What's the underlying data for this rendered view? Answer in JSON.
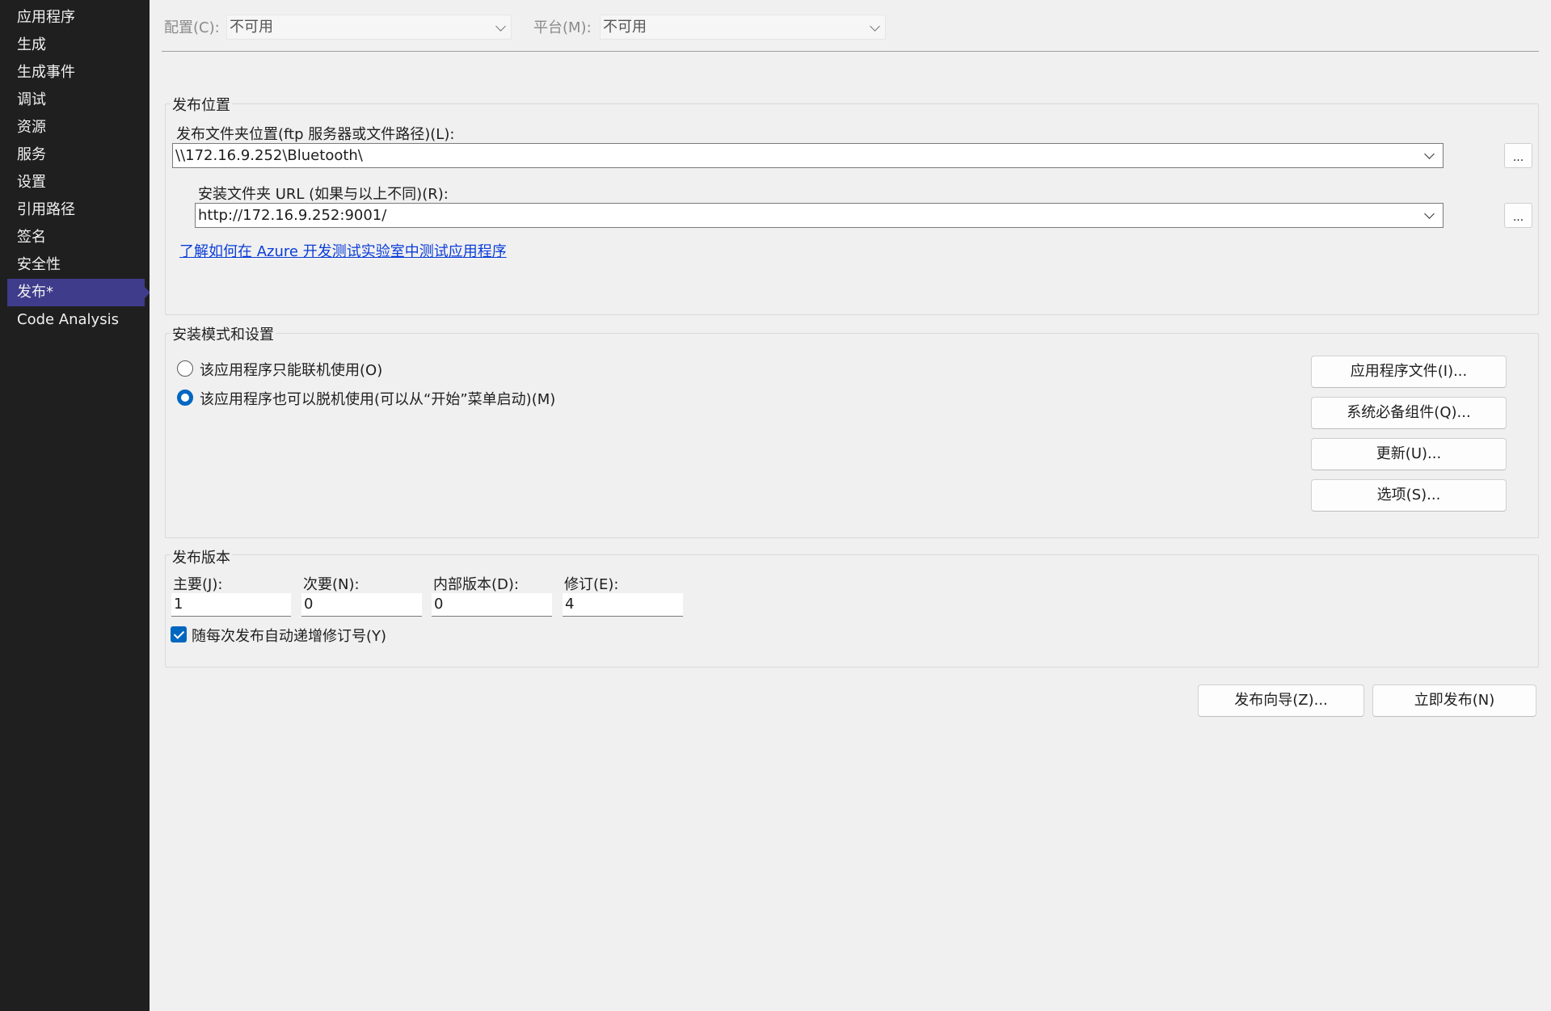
{
  "sidebar": {
    "items": [
      {
        "label": "应用程序"
      },
      {
        "label": "生成"
      },
      {
        "label": "生成事件"
      },
      {
        "label": "调试"
      },
      {
        "label": "资源"
      },
      {
        "label": "服务"
      },
      {
        "label": "设置"
      },
      {
        "label": "引用路径"
      },
      {
        "label": "签名"
      },
      {
        "label": "安全性"
      },
      {
        "label": "发布*",
        "active": true
      },
      {
        "label": "Code Analysis"
      }
    ]
  },
  "config": {
    "config_label": "配置(C):",
    "config_value": "不可用",
    "platform_label": "平台(M):",
    "platform_value": "不可用"
  },
  "publish_location": {
    "title": "发布位置",
    "folder_label": "发布文件夹位置(ftp 服务器或文件路径)(L):",
    "folder_value": "\\\\172.16.9.252\\Bluetooth\\",
    "url_label": "安装文件夹 URL (如果与以上不同)(R):",
    "url_value": "http://172.16.9.252:9001/",
    "browse_label": "...",
    "azure_link": "了解如何在 Azure 开发测试实验室中测试应用程序"
  },
  "install_mode": {
    "title": "安装模式和设置",
    "online_only": "该应用程序只能联机使用(O)",
    "offline_too": "该应用程序也可以脱机使用(可以从“开始”菜单启动)(M)",
    "selected": "offline_too",
    "buttons": {
      "app_files": "应用程序文件(I)...",
      "prerequisites": "系统必备组件(Q)...",
      "updates": "更新(U)...",
      "options": "选项(S)..."
    }
  },
  "publish_version": {
    "title": "发布版本",
    "major_label": "主要(J):",
    "major_value": "1",
    "minor_label": "次要(N):",
    "minor_value": "0",
    "build_label": "内部版本(D):",
    "build_value": "0",
    "revision_label": "修订(E):",
    "revision_value": "4",
    "auto_increment_label": "随每次发布自动递增修订号(Y)",
    "auto_increment_checked": true
  },
  "actions": {
    "wizard": "发布向导(Z)...",
    "publish_now": "立即发布(N)"
  }
}
